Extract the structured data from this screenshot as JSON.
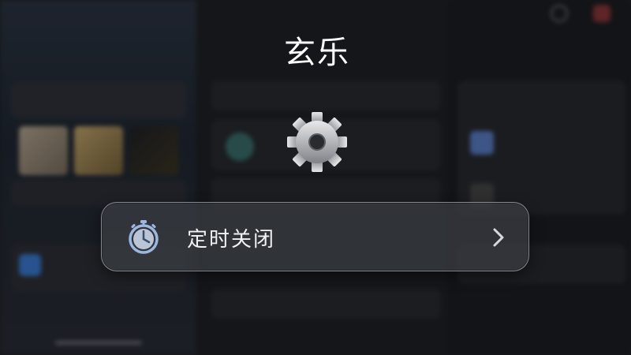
{
  "app": {
    "title": "玄乐"
  },
  "overlay_item": {
    "label": "定时关闭",
    "icon": "timer-icon",
    "chevron_icon": "chevron-right-icon"
  },
  "center_icon": "gear-icon",
  "colors": {
    "pill_border": "#c8cdd7",
    "pill_bg": "#3c3e44",
    "text_primary": "#ffffff",
    "timer_blue": "#9db8e0"
  }
}
